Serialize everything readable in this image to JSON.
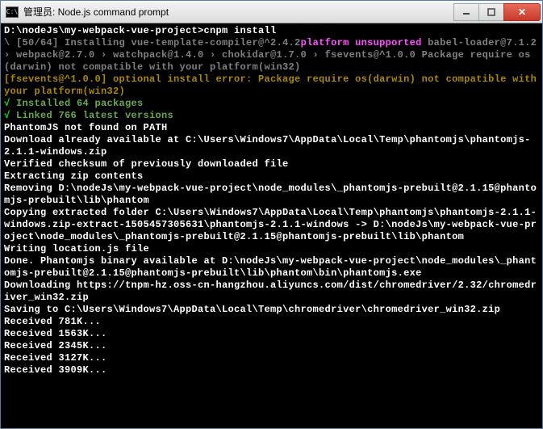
{
  "titlebar": {
    "icon_label": "C:\\",
    "title": "管理员: Node.js command prompt"
  },
  "window_controls": {
    "minimize": "minimize",
    "maximize": "maximize",
    "close": "close"
  },
  "terminal": {
    "prompt": "D:\\nodeJs\\my-webpack-vue-project>",
    "command": "cnpm install",
    "install_prefix": "\\ [50/64] Installing vue-template-compiler@^2.4.2",
    "platform_warn": "platform unsupported",
    "install_chain": " babel-loader@7.1.2 › webpack@2.7.0 › watchpack@1.4.0 › chokidar@1.7.0 › fsevents@^1.0.0 Package require os(darwin) not compatible with your platform(win32)",
    "optional_err": "[fsevents@^1.0.0] optional install error: Package require os(darwin) not compatible with your platform(win32)",
    "installed_check": "√",
    "installed": " Installed 64 packages",
    "linked_check": "√",
    "linked": " Linked 766 latest versions",
    "phantom_notfound": "PhantomJS not found on PATH",
    "download_avail": "Download already available at C:\\Users\\Windows7\\AppData\\Local\\Temp\\phantomjs\\phantomjs-2.1.1-windows.zip",
    "verified": "Verified checksum of previously downloaded file",
    "extracting": "Extracting zip contents",
    "removing": "Removing D:\\nodeJs\\my-webpack-vue-project\\node_modules\\_phantomjs-prebuilt@2.1.15@phantomjs-prebuilt\\lib\\phantom",
    "copying": "Copying extracted folder C:\\Users\\Windows7\\AppData\\Local\\Temp\\phantomjs\\phantomjs-2.1.1-windows.zip-extract-1505457305631\\phantomjs-2.1.1-windows -> D:\\nodeJs\\my-webpack-vue-project\\node_modules\\_phantomjs-prebuilt@2.1.15@phantomjs-prebuilt\\lib\\phantom",
    "writing": "Writing location.js file",
    "done": "Done. Phantomjs binary available at D:\\nodeJs\\my-webpack-vue-project\\node_modules\\_phantomjs-prebuilt@2.1.15@phantomjs-prebuilt\\lib\\phantom\\bin\\phantomjs.exe",
    "downloading": "Downloading https://tnpm-hz.oss-cn-hangzhou.aliyuncs.com/dist/chromedriver/2.32/chromedriver_win32.zip",
    "saving": "Saving to C:\\Users\\Windows7\\AppData\\Local\\Temp\\chromedriver\\chromedriver_win32.zip",
    "recv1": "Received 781K...",
    "recv2": "Received 1563K...",
    "recv3": "Received 2345K...",
    "recv4": "Received 3127K...",
    "recv5": "Received 3909K..."
  }
}
